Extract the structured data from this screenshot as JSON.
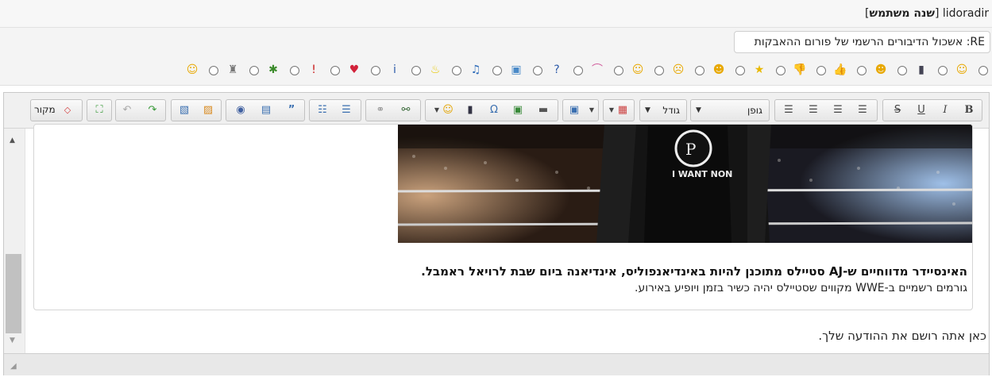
{
  "header": {
    "username": "lidoradir",
    "rank": "שנה משתמש"
  },
  "subject": {
    "value": "RE: אשכול הדיבורים הרשמי של פורום ההאבקות"
  },
  "smilies": [
    "smile-icon",
    "film-icon",
    "tongue-icon",
    "thumbs-up-icon",
    "thumbs-down-icon",
    "star-icon",
    "grin-icon",
    "confused-icon",
    "neutral-icon",
    "rainbow-icon",
    "question-icon",
    "image-icon",
    "music-note-icon",
    "lightbulb-icon",
    "info-icon",
    "heart-icon",
    "exclamation-icon",
    "bug-icon",
    "castle-icon",
    "laugh-icon"
  ],
  "toolbar": {
    "bold": "B",
    "italic": "I",
    "underline": "U",
    "strike": "S",
    "font_label": "גופן",
    "size_label": "גודל",
    "source_label": "מקור"
  },
  "content": {
    "headline": "האינסיידר מדווחיים ש-AJ סטיילס מתוכנן להיות באינדיאנפוליס, אינדיאנה ביום שבת לרויאל ראמבל.",
    "subline": "גורמים רשמיים ב-WWE מקווים שסטיילס יהיה כשיר בזמן ויופיע באירוע.",
    "shirt_text": "I WANT NON",
    "placeholder": "כאן אתה רושם את ההודעה שלך."
  },
  "colors": {
    "accent_red": "#d23b3b",
    "accent_green": "#3a9a3a",
    "toolbar_bg": "#f0f0f0"
  }
}
